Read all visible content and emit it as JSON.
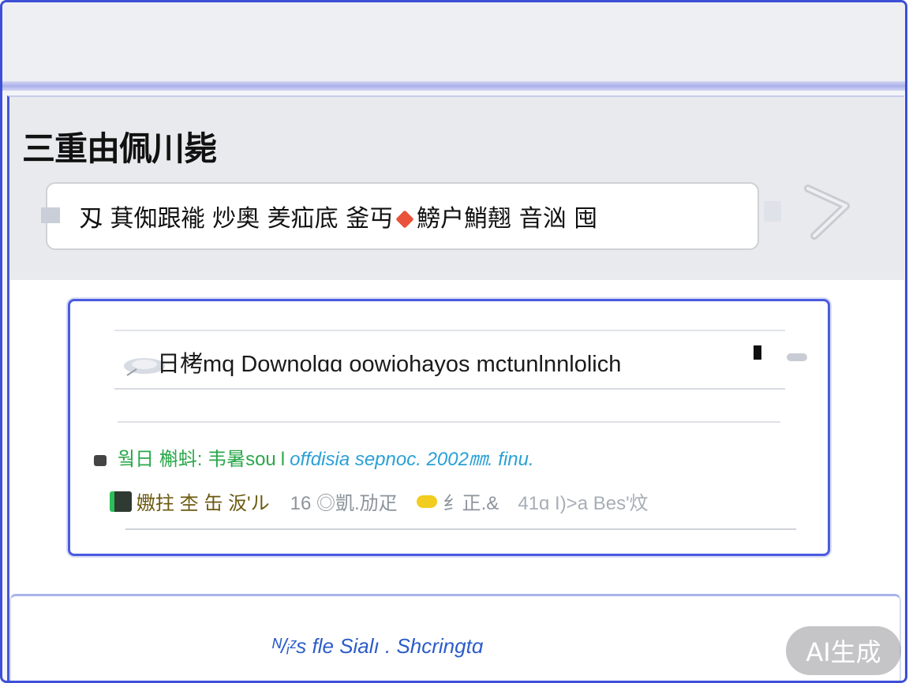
{
  "app": {
    "title": "三重由佩川毙"
  },
  "search": {
    "value_before": "刄 萁倁跟褦  炒奧 羑疝底 釜丏",
    "value_after": "鰟户鮹翹 音汹 囤"
  },
  "result": {
    "title": "日栲mq Downolɑɑ oowiohayos mctunlnnlolich",
    "meta_lead": "웤日 槲蚪: 韦暑sou",
    "meta_sep": "l",
    "meta_url": "offdisia sepnoc. 2002㎜. finu.",
    "stats_lead": "嫐拄 杢 缶 汳'ル",
    "stats_count": "16 ◎凱.劢疋",
    "stats_sublabel": "纟正.&",
    "stats_trail": "41ɑ I)>a Bes'炆"
  },
  "footer": {
    "link": "ᴺ/ᵢᶻs fle Sialı . Shcringtɑ"
  },
  "badge": {
    "label": "AI生成"
  },
  "colors": {
    "frame": "#3d4fd6",
    "accent_green": "#2aa84a",
    "accent_blue": "#2aa0d6",
    "link": "#2b5cc8",
    "chip": "#f2cc1e"
  }
}
